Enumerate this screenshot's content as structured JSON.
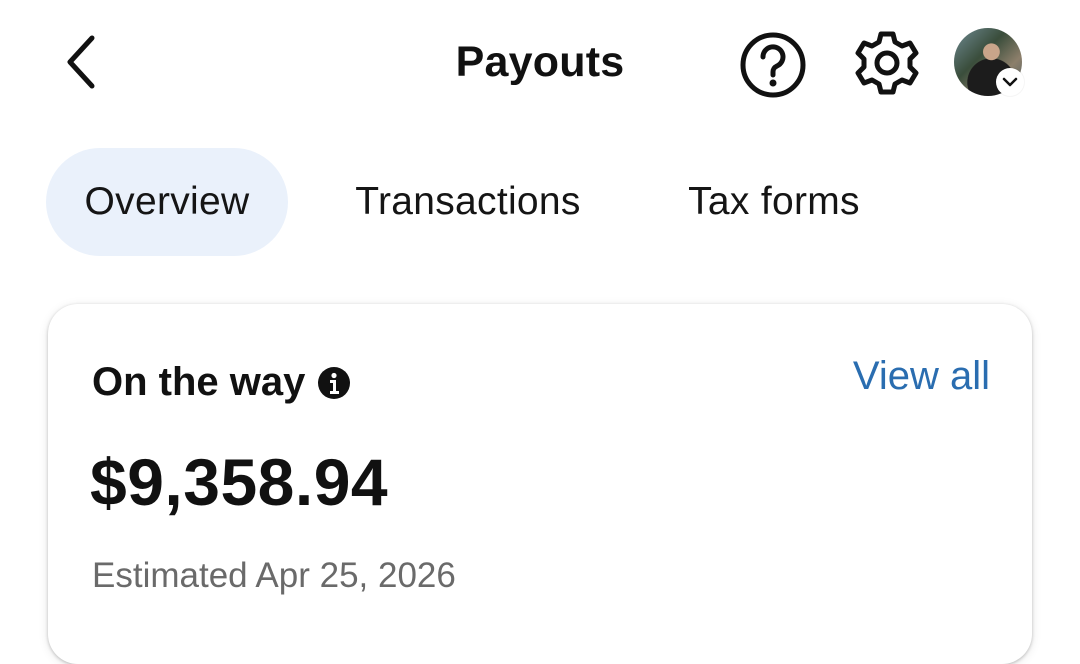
{
  "header": {
    "title": "Payouts",
    "back_icon": "chevron-left-icon",
    "help_icon": "question-circle-icon",
    "settings_icon": "gear-icon",
    "avatar_badge_icon": "chevron-down-icon"
  },
  "tabs": [
    {
      "label": "Overview",
      "active": true
    },
    {
      "label": "Transactions",
      "active": false
    },
    {
      "label": "Tax forms",
      "active": false
    }
  ],
  "card": {
    "title": "On the way",
    "info_icon": "info-icon",
    "view_all_label": "View all",
    "amount": "$9,358.94",
    "estimate": "Estimated Apr 25, 2026"
  },
  "colors": {
    "accent_link": "#2a6db0",
    "active_tab_bg": "#eaf1fb",
    "text_primary": "#111111",
    "text_secondary": "#6a6a6a"
  }
}
